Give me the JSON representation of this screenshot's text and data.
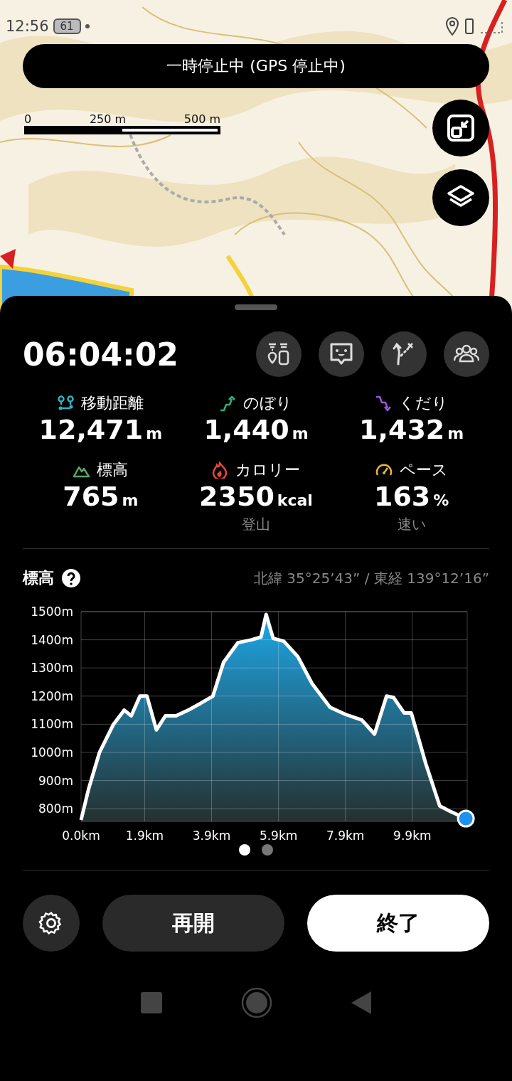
{
  "status_bar": {
    "time": "12:56",
    "battery": "61"
  },
  "map": {
    "kind": "picture",
    "banner": "一時停止中 (GPS 停止中)",
    "scale_labels": [
      "0",
      "250 m",
      "500 m"
    ]
  },
  "timer": "06:04:02",
  "stats": [
    {
      "kind": "distance",
      "label": "移動距離",
      "value": "12,471",
      "unit": "m",
      "color": "#2fb4c4"
    },
    {
      "kind": "ascent",
      "label": "のぼり",
      "value": "1,440",
      "unit": "m",
      "color": "#2fb07a"
    },
    {
      "kind": "descent",
      "label": "くだり",
      "value": "1,432",
      "unit": "m",
      "color": "#a055e0"
    },
    {
      "kind": "elevation",
      "label": "標高",
      "value": "765",
      "unit": "m",
      "color": "#5aa861"
    },
    {
      "kind": "calories",
      "label": "カロリー",
      "value": "2350",
      "unit": "kcal",
      "sub": "登山",
      "color": "#e8483a"
    },
    {
      "kind": "pace",
      "label": "ペース",
      "value": "163",
      "unit": "%",
      "sub": "速い",
      "color": "#e8b63a"
    }
  ],
  "elevation": {
    "title": "標高",
    "coordinates": "北緯 35°25’43” / 東経 139°12’16”",
    "chart_data": {
      "type": "area",
      "grid": true,
      "xlim": [
        0,
        11.54
      ],
      "ylim": [
        755,
        1500
      ],
      "xticks": [
        {
          "value": 0,
          "label": "0.0km"
        },
        {
          "value": 1.9,
          "label": "1.9km"
        },
        {
          "value": 3.9,
          "label": "3.9km"
        },
        {
          "value": 5.9,
          "label": "5.9km"
        },
        {
          "value": 7.9,
          "label": "7.9km"
        },
        {
          "value": 9.9,
          "label": "9.9km"
        }
      ],
      "yticks": [
        {
          "value": 800,
          "label": "800m"
        },
        {
          "value": 900,
          "label": "900m"
        },
        {
          "value": 1000,
          "label": "1000m"
        },
        {
          "value": 1100,
          "label": "1100m"
        },
        {
          "value": 1200,
          "label": "1200m"
        },
        {
          "value": 1300,
          "label": "1300m"
        },
        {
          "value": 1400,
          "label": "1400m"
        },
        {
          "value": 1500,
          "label": "1500m"
        }
      ],
      "x": [
        0,
        0.23,
        0.55,
        0.97,
        1.29,
        1.5,
        1.76,
        1.97,
        2.25,
        2.52,
        2.84,
        3.2,
        3.58,
        3.94,
        4.26,
        4.69,
        5.1,
        5.38,
        5.53,
        5.74,
        6.06,
        6.48,
        6.9,
        7.44,
        7.9,
        8.39,
        8.77,
        9.13,
        9.34,
        9.66,
        9.87,
        10.3,
        10.72,
        11.04,
        11.5
      ],
      "series": [
        {
          "color": "#ffffff",
          "values": [
            760,
            872,
            1000,
            1100,
            1150,
            1130,
            1200,
            1200,
            1080,
            1130,
            1130,
            1150,
            1175,
            1200,
            1320,
            1390,
            1400,
            1410,
            1490,
            1405,
            1395,
            1340,
            1245,
            1160,
            1135,
            1115,
            1065,
            1200,
            1195,
            1140,
            1140,
            960,
            810,
            790,
            765
          ]
        }
      ]
    }
  },
  "pages": [
    {
      "selected": true
    },
    {
      "selected": false
    }
  ],
  "buttons": {
    "resume": "再開",
    "finish": "終了"
  }
}
